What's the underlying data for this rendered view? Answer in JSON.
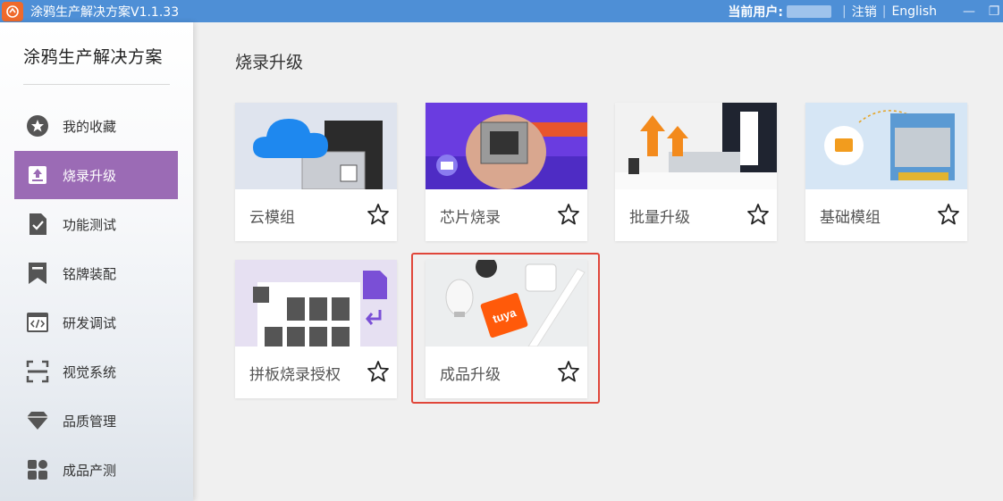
{
  "window": {
    "title": "涂鸦生产解决方案V1.1.33",
    "current_user_label": "当前用户:",
    "logout": "注销",
    "language": "English",
    "separator": "|",
    "minimize": "—",
    "restore": "❐"
  },
  "sidebar": {
    "brand": "涂鸦生产解决方案",
    "items": [
      {
        "label": "我的收藏",
        "icon": "star-circle-icon"
      },
      {
        "label": "烧录升级",
        "icon": "upload-icon",
        "active": true
      },
      {
        "label": "功能测试",
        "icon": "check-document-icon"
      },
      {
        "label": "铭牌装配",
        "icon": "bookmark-icon"
      },
      {
        "label": "研发调试",
        "icon": "code-window-icon"
      },
      {
        "label": "视觉系统",
        "icon": "scan-icon"
      },
      {
        "label": "品质管理",
        "icon": "diamond-icon"
      },
      {
        "label": "成品产测",
        "icon": "grid-icon"
      }
    ]
  },
  "main": {
    "title": "烧录升级",
    "cards": [
      {
        "label": "云模组"
      },
      {
        "label": "芯片烧录"
      },
      {
        "label": "批量升级"
      },
      {
        "label": "基础模组"
      },
      {
        "label": "拼板烧录授权"
      },
      {
        "label": "成品升级"
      }
    ],
    "product_tag_text": "tuya"
  },
  "colors": {
    "titlebar": "#4e8fd6",
    "active_nav": "#9b6bb5",
    "highlight_border": "#e0463a"
  }
}
